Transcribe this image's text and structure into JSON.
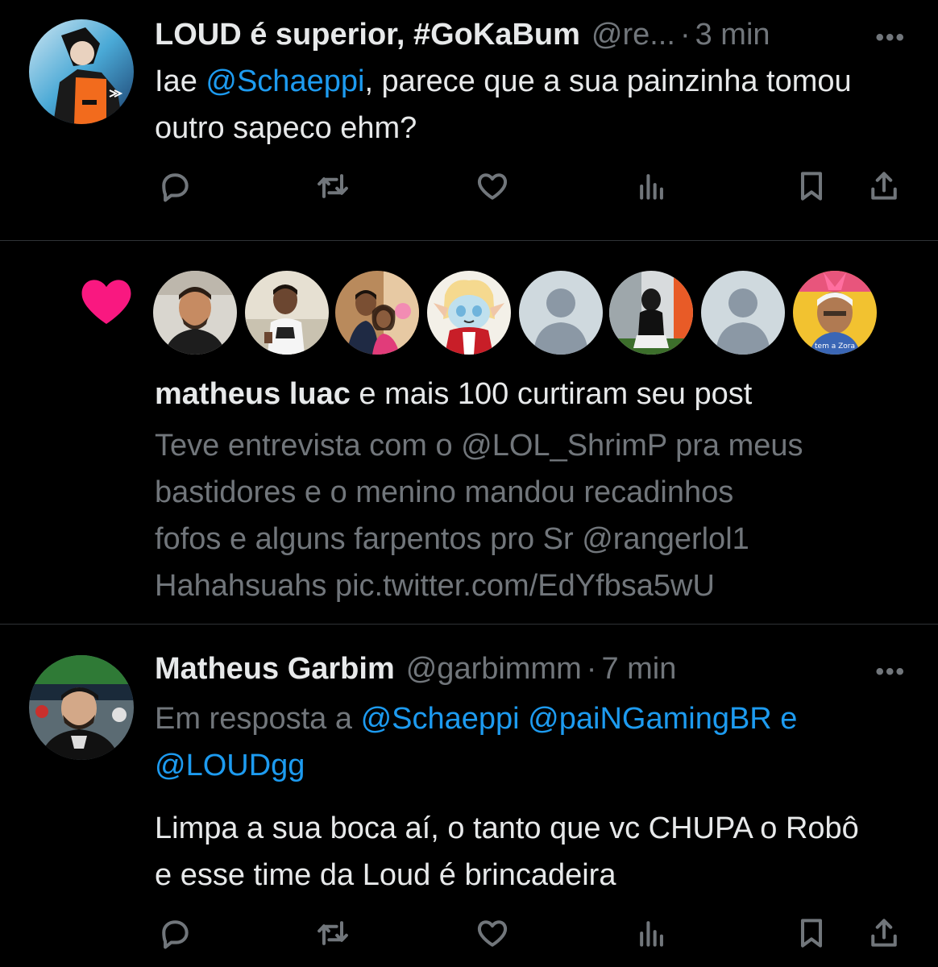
{
  "tweet1": {
    "name": "LOUD é superior, #GoKaBum",
    "handle": "@re...",
    "separator": "·",
    "time": "3 min",
    "more": "•••",
    "text_before": "Iae ",
    "mention": "@Schaeppi",
    "text_after": ", parece que a sua painzinha tomou outro sapeco ehm?"
  },
  "notification": {
    "name": "matheus luac",
    "text": " e mais 100 curtiram seu post",
    "preview_1": "Teve entrevista com o @LOL_ShrimP pra meus",
    "preview_2": "bastidores e o menino mandou recadinhos",
    "preview_3": "fofos e alguns farpentos pro Sr @rangerlol1",
    "preview_4": "Hahahsuahs pic.twitter.com/EdYfbsa5wU",
    "heart_color": "#f91880",
    "liker_caption": "tem a Zora"
  },
  "tweet2": {
    "name": "Matheus Garbim",
    "handle": "@garbimmm",
    "separator": "·",
    "time": "7 min",
    "more": "•••",
    "reply_prefix": "Em resposta a ",
    "reply_mention_1": "@Schaeppi",
    "reply_space": " ",
    "reply_mention_2": "@paiNGamingBR",
    "reply_and": " e",
    "reply_mention_3": "@LOUDgg",
    "text": "Limpa a sua boca aí, o tanto que vc CHUPA o Robô e esse time da Loud é brincadeira"
  },
  "colors": {
    "background": "#000000",
    "text": "#e7e9ea",
    "muted": "#71767b",
    "link": "#1d9bf0",
    "divider": "#2f3336"
  }
}
